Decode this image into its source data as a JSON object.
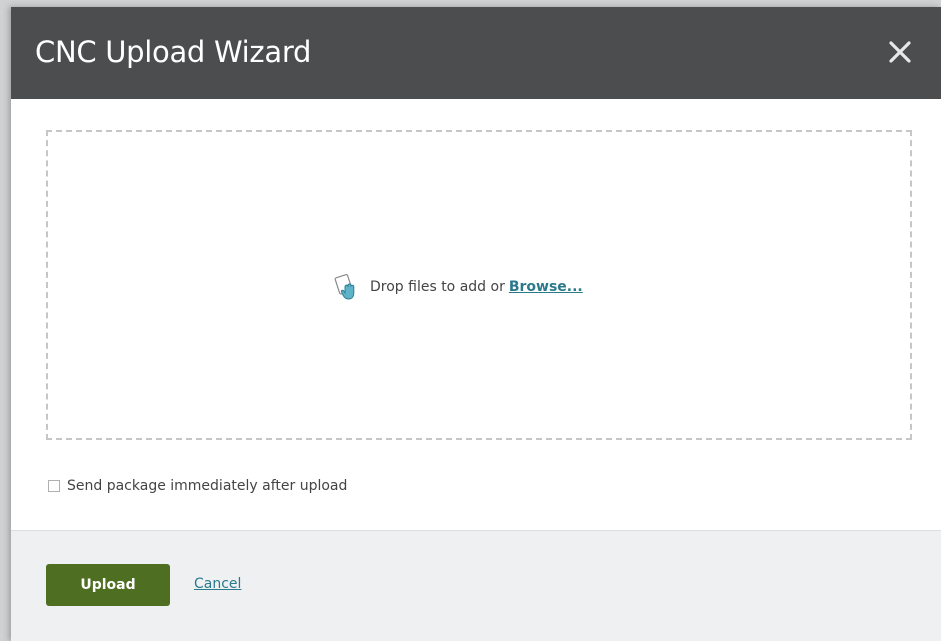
{
  "dialog": {
    "title": "CNC Upload Wizard",
    "close_icon": "close-icon"
  },
  "dropzone": {
    "icon": "drag-drop-hand-icon",
    "text": "Drop files to add or",
    "browse_label": "Browse..."
  },
  "options": {
    "send_immediately_label": "Send package immediately after upload",
    "send_immediately_checked": false
  },
  "footer": {
    "upload_label": "Upload",
    "cancel_label": "Cancel"
  },
  "colors": {
    "titlebar": "#4b4d4f",
    "primary_button": "#4e6e22",
    "link": "#2b7a8c",
    "footer_bg": "#eef0f2"
  }
}
